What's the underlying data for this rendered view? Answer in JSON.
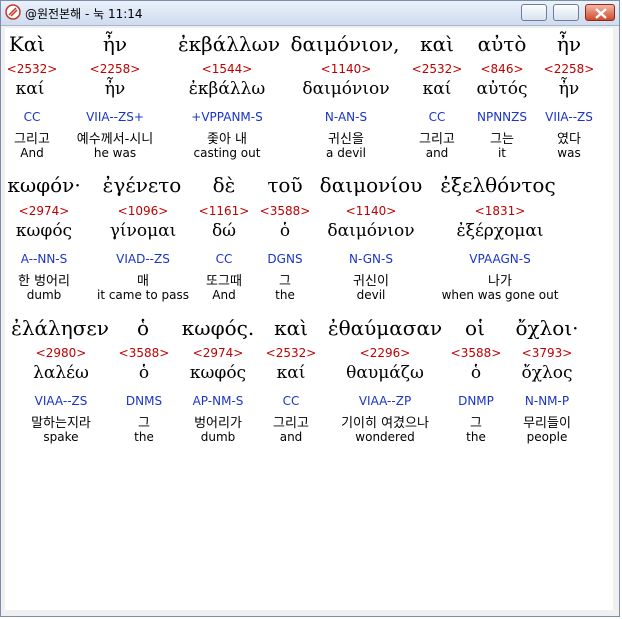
{
  "window": {
    "title": "@원전본해 - 눅 11:14",
    "minimize_glyph": "",
    "maximize_glyph": "",
    "close_glyph": ""
  },
  "rows": [
    {
      "words": [
        {
          "gk": "Καὶ",
          "num": "<2532>",
          "lemma": "καί",
          "pars": "CC",
          "ko": "그리고",
          "en": "And"
        },
        {
          "gk": "ἦν",
          "num": "<2258>",
          "lemma": "ἦν",
          "pars": "VIIA--ZS+",
          "ko": "예수께서-시니",
          "en": "he was"
        },
        {
          "gk": "ἐκβάλλων",
          "num": "<1544>",
          "lemma": "ἐκβάλλω",
          "pars": "+VPPANM-S",
          "ko": "좇아 내",
          "en": "casting out"
        },
        {
          "gk": "δαιμόνιον,",
          "num": "<1140>",
          "lemma": "δαιμόνιον",
          "pars": "N-AN-S",
          "ko": "귀신을",
          "en": "a devil"
        },
        {
          "gk": "καὶ",
          "num": "<2532>",
          "lemma": "καί",
          "pars": "CC",
          "ko": "그리고",
          "en": "and"
        },
        {
          "gk": "αὐτὸ",
          "num": "<846>",
          "lemma": "αὐτός",
          "pars": "NPNNZS",
          "ko": "그는",
          "en": "it"
        },
        {
          "gk": "ἦν",
          "num": "<2258>",
          "lemma": "ἦν",
          "pars": "VIIA--ZS",
          "ko": "였다",
          "en": "was"
        }
      ]
    },
    {
      "words": [
        {
          "gk": "κωφόν·",
          "num": "<2974>",
          "lemma": "κωφός",
          "pars": "A--NN-S",
          "ko": "한 벙어리",
          "en": "dumb"
        },
        {
          "gk": "ἐγένετο",
          "num": "<1096>",
          "lemma": "γίνομαι",
          "pars": "VIAD--ZS",
          "ko": "매",
          "en": "it came to pass"
        },
        {
          "gk": "δὲ",
          "num": "<1161>",
          "lemma": "δώ",
          "pars": "CC",
          "ko": "또그때",
          "en": "And"
        },
        {
          "gk": "τοῦ",
          "num": "<3588>",
          "lemma": "ὁ",
          "pars": "DGNS",
          "ko": "그",
          "en": "the"
        },
        {
          "gk": "δαιμονίου",
          "num": "<1140>",
          "lemma": "δαιμόνιον",
          "pars": "N-GN-S",
          "ko": "귀신이",
          "en": "devil"
        },
        {
          "gk": "ἐξελθόντος",
          "num": "<1831>",
          "lemma": "ἐξέρχομαι",
          "pars": "VPAAGN-S",
          "ko": "나가",
          "en": "when was gone out"
        }
      ]
    },
    {
      "words": [
        {
          "gk": "ἐλάλησεν",
          "num": "<2980>",
          "lemma": "λαλέω",
          "pars": "VIAA--ZS",
          "ko": "말하는지라",
          "en": "spake"
        },
        {
          "gk": "ὁ",
          "num": "<3588>",
          "lemma": "ὁ",
          "pars": "DNMS",
          "ko": "그",
          "en": "the"
        },
        {
          "gk": "κωφός.",
          "num": "<2974>",
          "lemma": "κωφός",
          "pars": "AP-NM-S",
          "ko": "벙어리가",
          "en": "dumb"
        },
        {
          "gk": "καὶ",
          "num": "<2532>",
          "lemma": "καί",
          "pars": "CC",
          "ko": "그리고",
          "en": "and"
        },
        {
          "gk": "ἐθαύμασαν",
          "num": "<2296>",
          "lemma": "θαυμάζω",
          "pars": "VIAA--ZP",
          "ko": "기이히 여겼으나",
          "en": "wondered"
        },
        {
          "gk": "οἱ",
          "num": "<3588>",
          "lemma": "ὁ",
          "pars": "DNMP",
          "ko": "그",
          "en": "the"
        },
        {
          "gk": "ὄχλοι·",
          "num": "<3793>",
          "lemma": "ὄχλος",
          "pars": "N-NM-P",
          "ko": "무리들이",
          "en": "people"
        }
      ]
    }
  ]
}
